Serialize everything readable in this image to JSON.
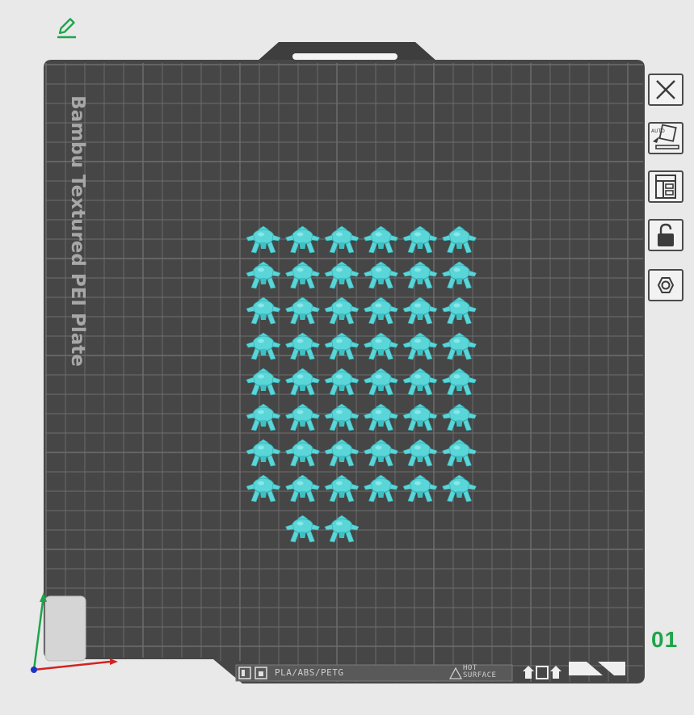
{
  "plate": {
    "name": "Bambu Textured PEI Plate",
    "number": "01",
    "filament_label": "PLA/ABS/PETG",
    "warning_label_line1": "HOT",
    "warning_label_line2": "SURFACE"
  },
  "objects": {
    "count": 50,
    "columns": 6,
    "full_rows": 8,
    "last_row_count": 2
  },
  "toolbar": [
    {
      "name": "delete-plate-button",
      "icon": "close-icon"
    },
    {
      "name": "auto-orient-button",
      "icon": "auto-orient-icon",
      "icon_text": "AUTO"
    },
    {
      "name": "arrange-button",
      "icon": "arrange-layout-icon"
    },
    {
      "name": "lock-plate-button",
      "icon": "lock-icon"
    },
    {
      "name": "plate-settings-button",
      "icon": "hexagon-nut-icon"
    }
  ],
  "colors": {
    "plate": "#464646",
    "grid": "#6e6e6e",
    "object": "#5ad5d8",
    "accent_green": "#1ea54b",
    "axis_x": "#d42222",
    "axis_y": "#1ea54b",
    "axis_z": "#1b35c8"
  }
}
